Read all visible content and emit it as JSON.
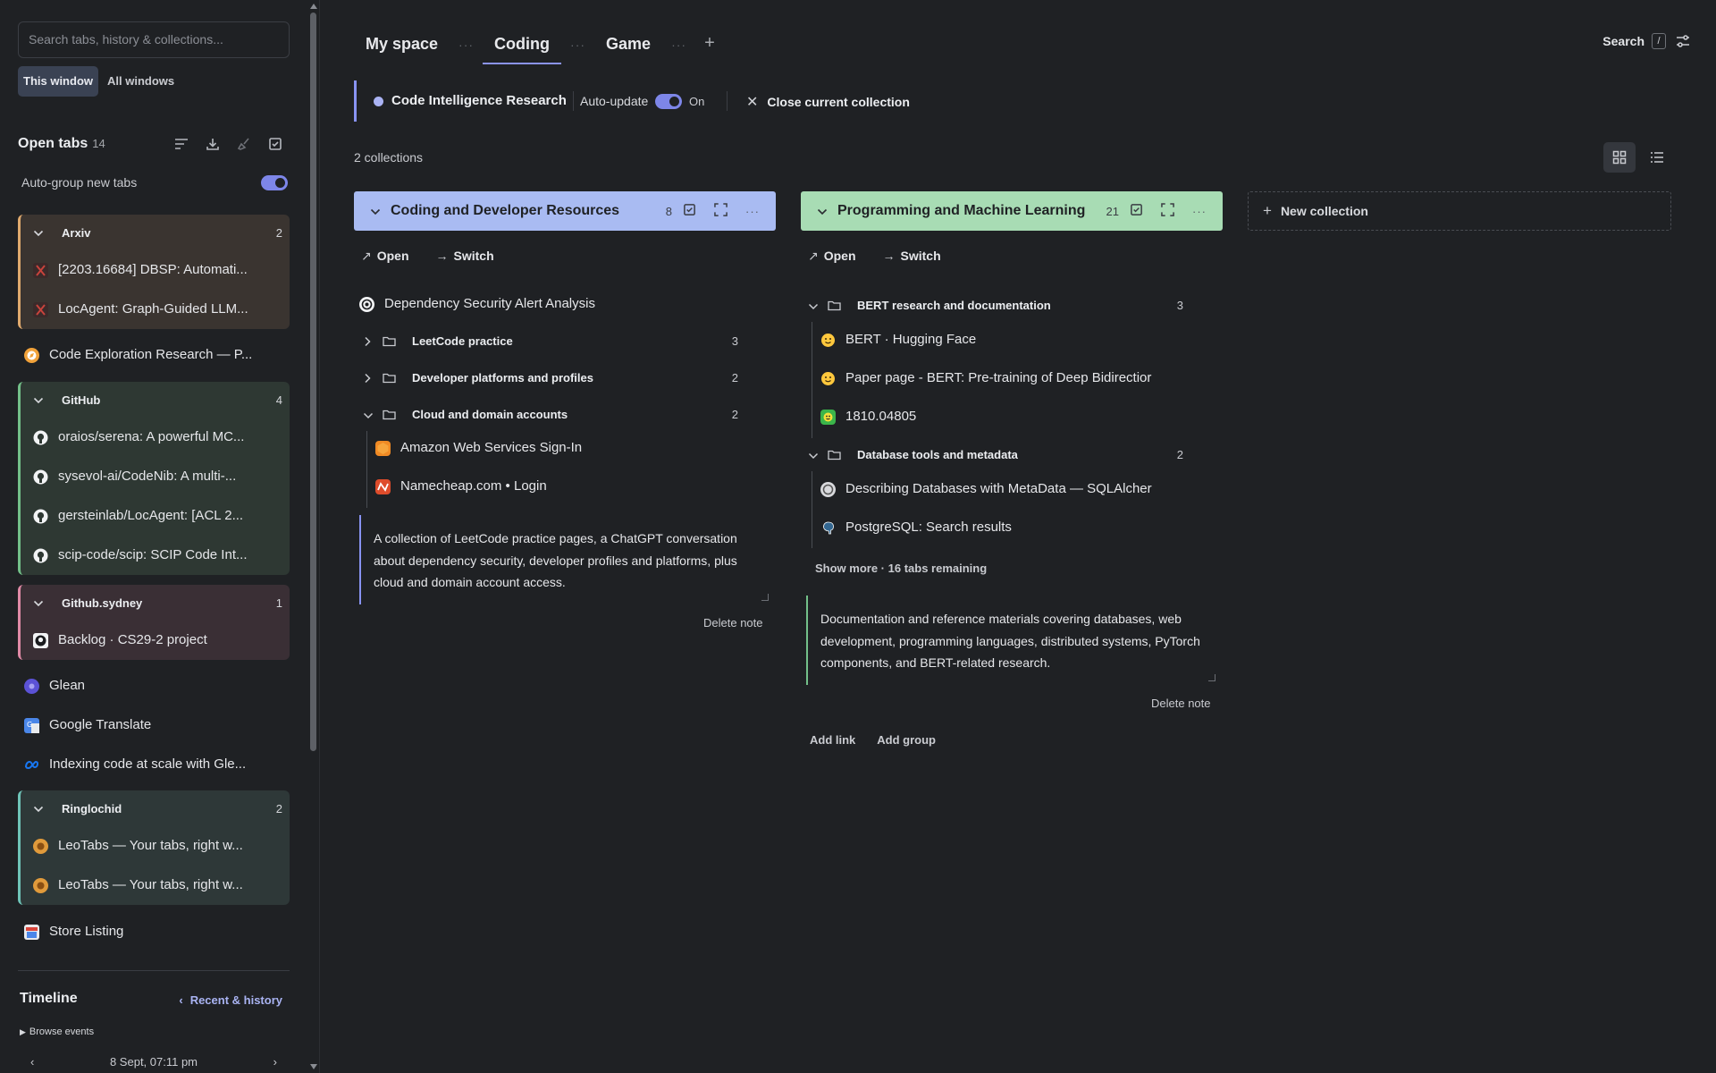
{
  "sidebar": {
    "search_placeholder": "Search tabs, history & collections...",
    "window_options": [
      "This window",
      "All windows"
    ],
    "open_tabs_title": "Open tabs",
    "open_tabs_count": "14",
    "autogroup_label": "Auto-group new tabs",
    "groups": [
      {
        "name": "Arxiv",
        "count": "2",
        "color": "#e0aa6e",
        "bg": "#3a3430",
        "tabs": [
          "[2203.16684] DBSP: Automati...",
          "LocAgent: Graph-Guided LLM..."
        ]
      },
      {
        "name": "GitHub",
        "count": "4",
        "color": "#73c089",
        "bg": "#2e3833",
        "tabs": [
          "oraios/serena: A powerful MC...",
          "sysevol-ai/CodeNib: A multi-...",
          "gersteinlab/LocAgent: [ACL 2...",
          "scip-code/scip: SCIP Code Int..."
        ]
      },
      {
        "name": "Github.sydney",
        "count": "1",
        "color": "#e08aa6",
        "bg": "#3a2f35",
        "tabs": [
          "Backlog · CS29-2 project"
        ]
      },
      {
        "name": "Ringlochid",
        "count": "2",
        "color": "#6fc4b8",
        "bg": "#2e3838",
        "tabs": [
          "LeoTabs — Your tabs, right w...",
          "LeoTabs — Your tabs, right w..."
        ]
      }
    ],
    "loose_tabs": {
      "code_exploration": "Code Exploration Research — P...",
      "glean": "Glean",
      "google_translate": "Google Translate",
      "indexing": "Indexing code at scale with Gle...",
      "store_listing": "Store Listing"
    },
    "timeline_title": "Timeline",
    "timeline_link": "Recent & history",
    "browse_events": "Browse events",
    "date": "8 Sept, 07:11 pm"
  },
  "spaces": {
    "tabs": [
      "My space",
      "Coding",
      "Game"
    ],
    "active": "Coding",
    "search_label": "Search",
    "search_key": "/"
  },
  "collection_bar": {
    "name": "Code Intelligence Research",
    "auto_update_label": "Auto-update",
    "auto_update_state": "On",
    "close_label": "Close current collection"
  },
  "collections_count": "2 collections",
  "collections": [
    {
      "name": "Coding and Developer Resources",
      "count": "8",
      "color": "#a9bbf2",
      "open_label": "Open",
      "switch_label": "Switch",
      "top_item": "Dependency Security Alert Analysis",
      "folders": [
        {
          "name": "LeetCode practice",
          "count": "3",
          "expanded": false
        },
        {
          "name": "Developer platforms and profiles",
          "count": "2",
          "expanded": false
        },
        {
          "name": "Cloud and domain accounts",
          "count": "2",
          "expanded": true,
          "items": [
            "Amazon Web Services Sign-In",
            "Namecheap.com • Login"
          ]
        }
      ],
      "note": "A collection of LeetCode practice pages, a ChatGPT conversation about dependency security, developer profiles and platforms, plus cloud and domain account access.",
      "note_color": "#8893f2",
      "delete_note": "Delete note"
    },
    {
      "name": "Programming and Machine Learning",
      "count": "21",
      "color": "#a8dcb4",
      "open_label": "Open",
      "switch_label": "Switch",
      "folders": [
        {
          "name": "BERT research and documentation",
          "count": "3",
          "expanded": true,
          "items": [
            "BERT · Hugging Face",
            "Paper page - BERT: Pre-training of Deep Bidirectior",
            "1810.04805"
          ]
        },
        {
          "name": "Database tools and metadata",
          "count": "2",
          "expanded": true,
          "items": [
            "Describing Databases with MetaData — SQLAlcher",
            "PostgreSQL: Search results"
          ]
        }
      ],
      "show_more": "Show more · 16 tabs remaining",
      "note": "Documentation and reference materials covering databases, web development, programming languages, distributed systems, PyTorch components, and BERT-related research.",
      "note_color": "#73c089",
      "delete_note": "Delete note",
      "add_link": "Add link",
      "add_group": "Add group"
    }
  ],
  "new_collection_label": "New collection"
}
